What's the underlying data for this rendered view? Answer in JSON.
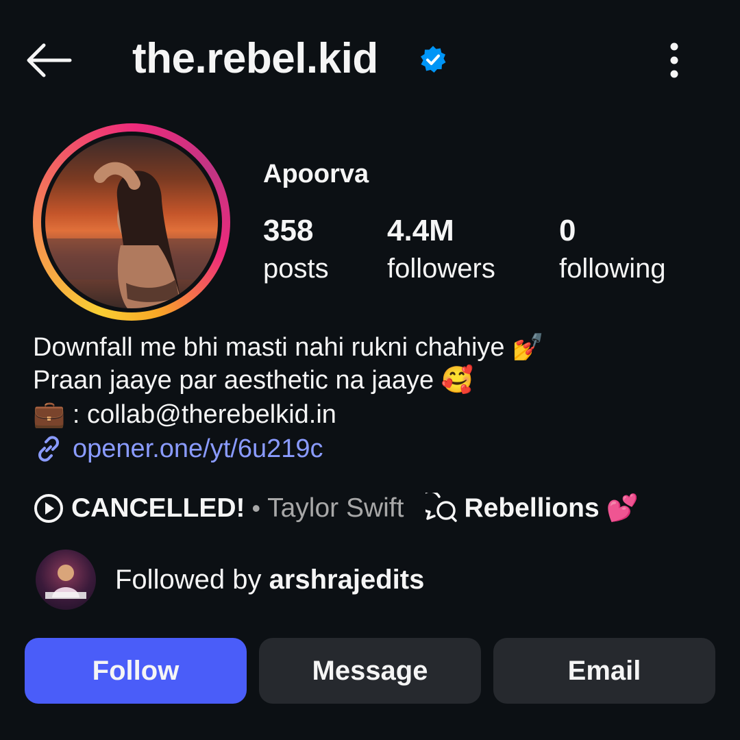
{
  "header": {
    "username": "the.rebel.kid",
    "verified": true,
    "icons": [
      "back-arrow-icon",
      "verified-badge-icon",
      "more-options-icon"
    ]
  },
  "profile": {
    "display_name": "Apoorva",
    "stats": [
      {
        "value": "358",
        "label": "posts"
      },
      {
        "value": "4.4M",
        "label": "followers"
      },
      {
        "value": "0",
        "label": "following"
      }
    ],
    "bio": {
      "line1": "Downfall me bhi masti nahi rukni chahiye",
      "line1_emoji": "💅",
      "line2": "Praan jaaye par aesthetic na jaaye",
      "line2_emoji": "🥰",
      "line3_emoji": "💼",
      "line3": ": collab@therebelkid.in",
      "link": "opener.one/yt/6u219c"
    },
    "music": {
      "title": "CANCELLED!",
      "separator": "•",
      "artist": "Taylor Swift"
    },
    "thread": {
      "label": "Rebellions",
      "emoji": "💕"
    },
    "followed_by": {
      "prefix": "Followed by ",
      "user": "arshrajedits"
    }
  },
  "actions": {
    "follow": "Follow",
    "message": "Message",
    "email": "Email"
  },
  "colors": {
    "background": "#0c1014",
    "follow_button": "#4a5df9",
    "secondary_button": "#26292e",
    "link": "#8a9bff",
    "verified": "#0095f6",
    "muted_text": "#a8a8a8"
  }
}
